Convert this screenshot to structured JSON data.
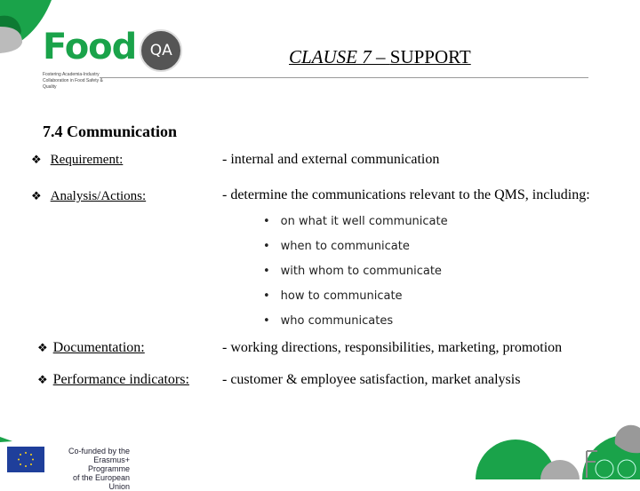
{
  "header": {
    "logo_text": "Food",
    "logo_badge": "QA",
    "logo_tagline": "Fostering Academia-Industry Collaboration in Food Safety & Quality",
    "title_italic": "CLAUSE 7 –",
    "title_rest": "SUPPORT"
  },
  "section": {
    "heading": "7.4 Communication"
  },
  "rows": [
    {
      "label": "Requirement:",
      "value": "- internal and external communication"
    },
    {
      "label": "Analysis/Actions:",
      "value": "- determine the communications relevant to the QMS, including:"
    },
    {
      "label": "Documentation:",
      "value": "- working directions, responsibilities, marketing, promotion"
    },
    {
      "label": "Performance indicators:",
      "value": "- customer & employee satisfaction, market analysis"
    }
  ],
  "bullets": [
    "on what it well communicate",
    "when to communicate",
    "with whom to communicate",
    "how to communicate",
    "who communicates"
  ],
  "footer": {
    "eu_line1": "Co-funded by the",
    "eu_line2": "Erasmus+ Programme",
    "eu_line3": "of the European Union"
  },
  "colors": {
    "brand_green": "#1aa34a",
    "dark_grey": "#555555",
    "eu_blue": "#1f3f9b"
  }
}
